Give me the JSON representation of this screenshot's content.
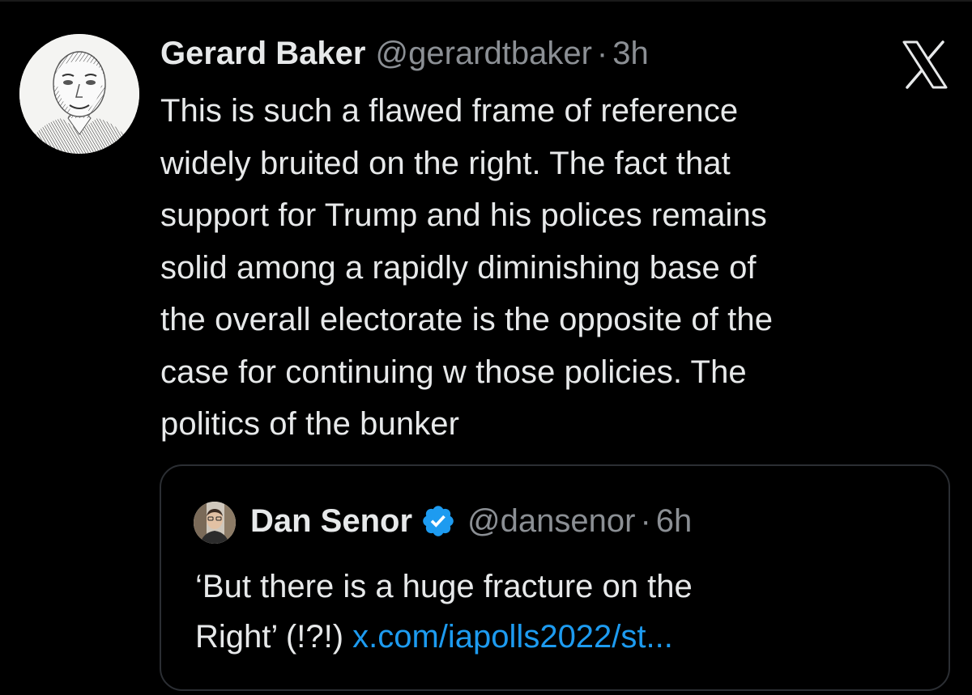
{
  "tweet": {
    "author_name": "Gerard Baker",
    "author_handle": "@gerardtbaker",
    "separator": "·",
    "time": "3h",
    "avatar_icon": "author-portrait-avatar",
    "lines": [
      "This is such a flawed frame of reference",
      "widely bruited on the right. The fact that",
      "support for Trump and his polices remains",
      "solid among a rapidly diminishing base of",
      "the overall electorate is the opposite of the",
      "case for continuing w those policies. The",
      "politics of the bunker"
    ]
  },
  "quote": {
    "author_name": "Dan Senor",
    "author_handle": "@dansenor",
    "separator": "·",
    "time": "6h",
    "verified_icon": "verified-badge-icon",
    "text_line1": "‘But there is a huge fracture on the",
    "text_line2": "Right’ (!?!) ",
    "link_text": "x.com/iapolls2022/st..."
  },
  "brand": {
    "logo": "x-logo-icon"
  },
  "colors": {
    "background": "#000000",
    "text": "#e7e9ea",
    "muted": "#8b8f94",
    "link": "#1d9bf0",
    "border": "#2b2e33"
  }
}
